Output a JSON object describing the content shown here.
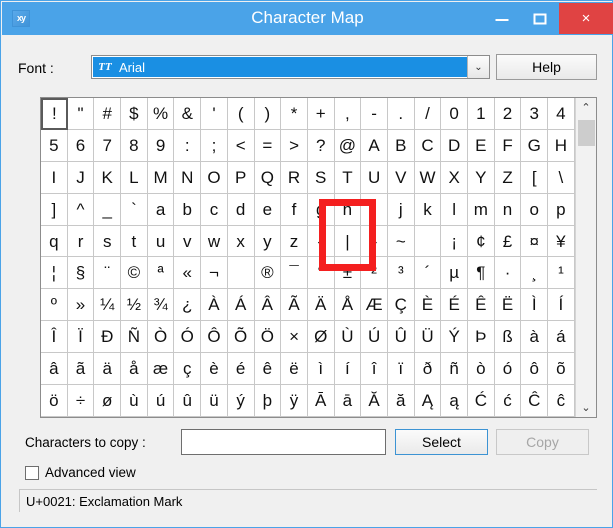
{
  "window": {
    "title": "Character Map",
    "icon": "character-map-app-icon",
    "caption_buttons": {
      "minimize": "minimize-icon",
      "maximize": "maximize-icon",
      "close": "×"
    }
  },
  "font_row": {
    "label": "Font :",
    "selected_font": "Arial",
    "font_icon": "truetype-icon",
    "dropdown_arrow": "⌄",
    "help_label": "Help"
  },
  "grid": {
    "columns": 20,
    "selected_index": 0,
    "rows": [
      [
        "!",
        "\"",
        "#",
        "$",
        "%",
        "&",
        "'",
        "(",
        ")",
        "*",
        "+",
        ",",
        "-",
        ".",
        "/",
        "0",
        "1",
        "2",
        "3",
        "4"
      ],
      [
        "5",
        "6",
        "7",
        "8",
        "9",
        ":",
        ";",
        "<",
        "=",
        ">",
        "?",
        "@",
        "A",
        "B",
        "C",
        "D",
        "E",
        "F",
        "G",
        "H"
      ],
      [
        "I",
        "J",
        "K",
        "L",
        "M",
        "N",
        "O",
        "P",
        "Q",
        "R",
        "S",
        "T",
        "U",
        "V",
        "W",
        "X",
        "Y",
        "Z",
        "[",
        "\\"
      ],
      [
        "]",
        "^",
        "_",
        "`",
        "a",
        "b",
        "c",
        "d",
        "e",
        "f",
        "g",
        "h",
        "i",
        "j",
        "k",
        "l",
        "m",
        "n",
        "o",
        "p"
      ],
      [
        "q",
        "r",
        "s",
        "t",
        "u",
        "v",
        "w",
        "x",
        "y",
        "z",
        "{",
        "|",
        "}",
        "~",
        "",
        "¡",
        "¢",
        "£",
        "¤",
        "¥"
      ],
      [
        "¦",
        "§",
        "¨",
        "©",
        "ª",
        "«",
        "¬",
        "­",
        "®",
        "¯",
        "°",
        "±",
        "²",
        "³",
        "´",
        "µ",
        "¶",
        "·",
        "¸",
        "¹"
      ],
      [
        "º",
        "»",
        "¼",
        "½",
        "¾",
        "¿",
        "À",
        "Á",
        "Â",
        "Ã",
        "Ä",
        "Å",
        "Æ",
        "Ç",
        "È",
        "É",
        "Ê",
        "Ë",
        "Ì",
        "Í"
      ],
      [
        "Î",
        "Ï",
        "Ð",
        "Ñ",
        "Ò",
        "Ó",
        "Ô",
        "Õ",
        "Ö",
        "×",
        "Ø",
        "Ù",
        "Ú",
        "Û",
        "Ü",
        "Ý",
        "Þ",
        "ß",
        "à",
        "á"
      ],
      [
        "â",
        "ã",
        "ä",
        "å",
        "æ",
        "ç",
        "è",
        "é",
        "ê",
        "ë",
        "ì",
        "í",
        "î",
        "ï",
        "ð",
        "ñ",
        "ò",
        "ó",
        "ô",
        "õ"
      ],
      [
        "ö",
        "÷",
        "ø",
        "ù",
        "ú",
        "û",
        "ü",
        "ý",
        "þ",
        "ÿ",
        "Ā",
        "ā",
        "Ă",
        "ă",
        "Ą",
        "ą",
        "Ć",
        "ć",
        "Ĉ",
        "ĉ"
      ]
    ],
    "scrollbar": {
      "up_arrow": "⌃",
      "down_arrow": "⌄"
    }
  },
  "annotation": {
    "shape": "red-rectangle-highlight",
    "target_character": "|",
    "color": "#f41f1f"
  },
  "bottom": {
    "copy_label": "Characters to copy :",
    "copy_input_value": "",
    "copy_input_placeholder": "",
    "select_label": "Select",
    "copy_button_label": "Copy",
    "copy_button_enabled": false,
    "advanced_view_label": "Advanced view",
    "advanced_view_checked": false
  },
  "status": {
    "text": "U+0021: Exclamation Mark"
  },
  "colors": {
    "titlebar": "#4aa3e8",
    "close_button": "#e04343",
    "selection_blue": "#1a8fe3",
    "annotation_red": "#f41f1f"
  }
}
